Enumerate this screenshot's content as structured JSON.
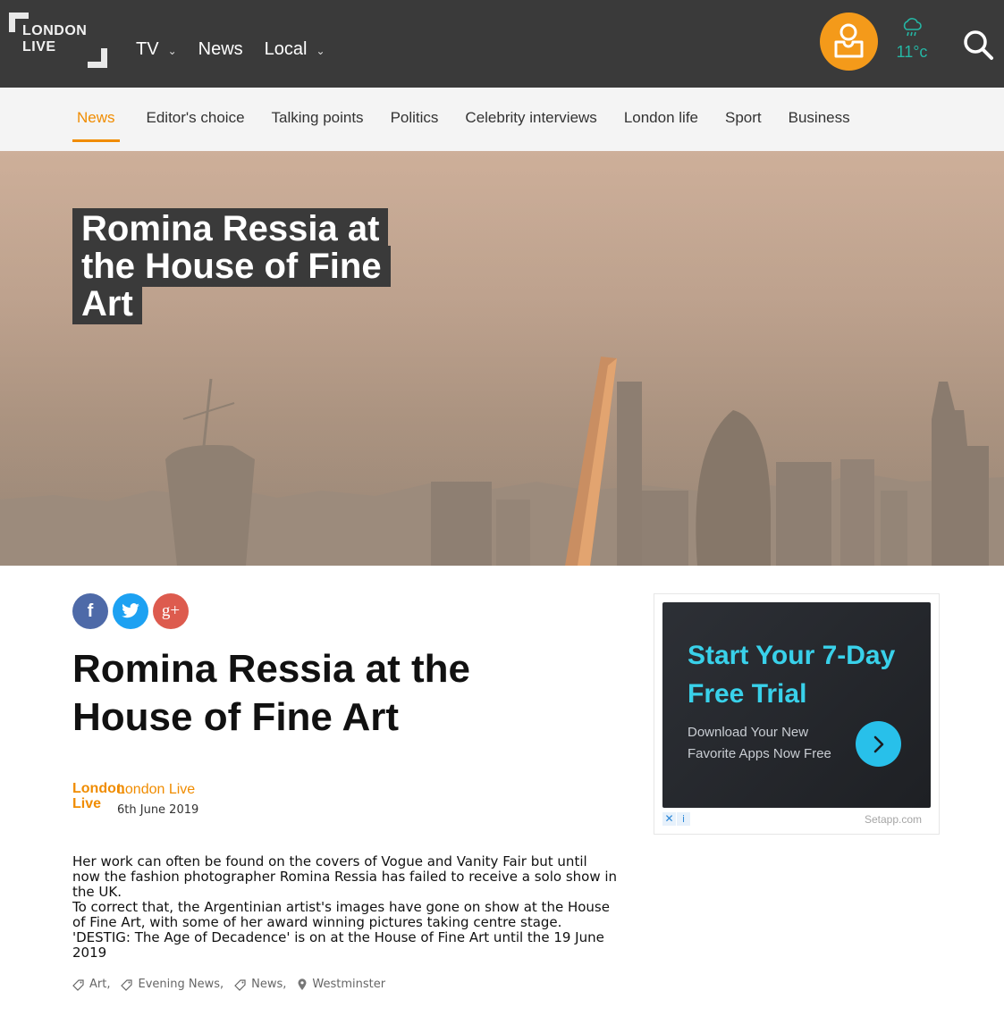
{
  "header": {
    "logo_line1": "LONDON",
    "logo_line2": "LIVE",
    "nav": [
      {
        "label": "TV",
        "has_dropdown": true
      },
      {
        "label": "News",
        "has_dropdown": false
      },
      {
        "label": "Local",
        "has_dropdown": true
      }
    ],
    "weather": {
      "temp": "11°c",
      "icon": "rain-cloud-icon"
    },
    "icons": {
      "user": "user-profile-icon",
      "search": "search-icon"
    },
    "colors": {
      "bar": "#3a3a3a",
      "user_btn": "#f49a1a",
      "weather": "#25b7a5"
    }
  },
  "section_nav": {
    "items": [
      "News",
      "Editor's choice",
      "Talking points",
      "Politics",
      "Celebrity interviews",
      "London life",
      "Sport",
      "Business"
    ],
    "active": "News",
    "active_color": "#f08c00"
  },
  "hero": {
    "title": "Romina Ressia at the House of Fine Art"
  },
  "article": {
    "share": {
      "facebook": "f",
      "google_plus": "g+"
    },
    "title": "Romina Ressia at the House of Fine Art",
    "author_logo_line1": "London",
    "author_logo_line2": "Live",
    "author": "London Live",
    "date": "6th June 2019",
    "paragraphs": [
      "Her work can often be found on the covers of Vogue and Vanity Fair but until now the fashion photographer Romina Ressia has failed to receive a solo show in the UK.",
      "To correct that, the Argentinian artist's images have gone on show at the House of Fine Art, with some of her award winning pictures taking centre stage.",
      "'DESTIG: The Age of Decadence' is on at the House of Fine Art until the 19 June 2019"
    ],
    "tags": [
      "Art",
      "Evening News",
      "News"
    ],
    "location": "Westminster",
    "tag_separator": ","
  },
  "ad": {
    "headline": "Start Your 7-Day Free Trial",
    "subtext": "Download Your New Favorite Apps Now Free",
    "close_label": "✕",
    "info_label": "i",
    "domain": "Setapp.com",
    "accent": "#39d1ea"
  }
}
